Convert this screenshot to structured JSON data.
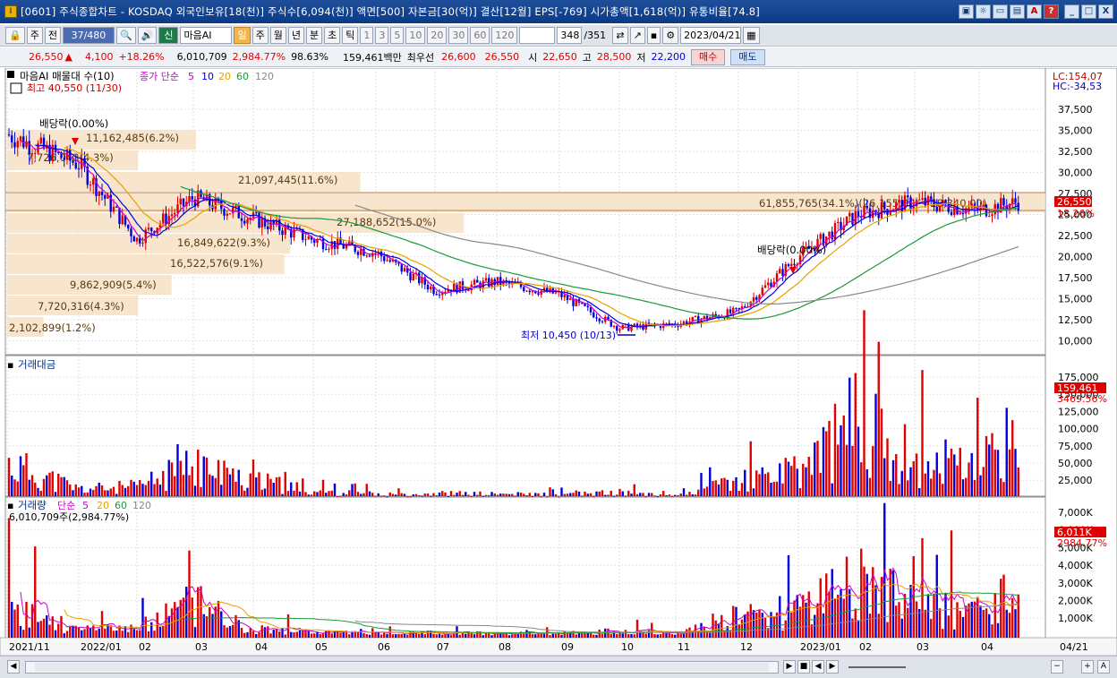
{
  "window": {
    "icon_glyph": "I",
    "title": "[0601] 주식종합차트 - KOSDAQ 외국인보유[18(천)] 주식수[6,094(천)] 액면[500] 자본금[30(억)] 결산[12월] EPS[-769] 시가총액[1,618(억)] 유통비율[74.8]",
    "buttons": [
      "▣",
      "☼",
      "▭",
      "▤",
      "A",
      "?",
      "_",
      "□",
      "X"
    ]
  },
  "toolbar": {
    "mode": "주",
    "range": "전",
    "code": "37/480",
    "name": "마음AI",
    "tag": "신",
    "periods": [
      "일",
      "주",
      "월",
      "년",
      "분",
      "초",
      "틱"
    ],
    "intervals": [
      "1",
      "3",
      "5",
      "10",
      "20",
      "30",
      "60",
      "120"
    ],
    "count": "348",
    "total": "/351",
    "date": "2023/04/21"
  },
  "quote": {
    "price": "26,550",
    "change": "4,100",
    "pct": "+18.26%",
    "volume": "6,010,709",
    "vol_pct": "2,984.77%",
    "strength": "98.63%",
    "amount": "159,461백만",
    "pref_label": "최우선",
    "bid": "26,600",
    "ask": "26,550",
    "open_label": "시",
    "open": "22,650",
    "high_label": "고",
    "high": "28,500",
    "low_label": "저",
    "low": "22,200",
    "buy": "매수",
    "sell": "매도"
  },
  "main_panel": {
    "title": "마음AI 매물대 수(10)",
    "ma_label": "종가 단순",
    "ma_periods": [
      "5",
      "10",
      "20",
      "60",
      "120"
    ],
    "ma_colors": [
      "#cc00cc",
      "#0000dd",
      "#e8a000",
      "#1a9a3a",
      "#888888"
    ],
    "high_note": "최고 40,550 (11/30)",
    "low_note": "최저 10,450 (10/13)",
    "lc": "LC:154,07",
    "hc": "HC:-34,53",
    "price_ticks": [
      "37,500",
      "35,000",
      "32,500",
      "30,000",
      "27,500",
      "25,000",
      "22,500",
      "20,000",
      "17,500",
      "15,000",
      "12,500",
      "10,000"
    ],
    "last_price": "26,550",
    "last_pct": "18.26%",
    "profile": [
      {
        "label": "61,855,765(34.1%)(26,155.00 ~ 28,340.00)",
        "pct": 34.1
      },
      {
        "label": "21,097,445(11.6%)",
        "pct": 11.6
      },
      {
        "label": "11,162,485(6.2%)",
        "pct": 6.2
      },
      {
        "label": "7,726,043(4.3%)",
        "pct": 4.3
      },
      {
        "label": "27,188,652(15.0%)",
        "pct": 15.0
      },
      {
        "label": "16,849,622(9.3%)",
        "pct": 9.3
      },
      {
        "label": "16,522,576(9.1%)",
        "pct": 9.1
      },
      {
        "label": "9,862,909(5.4%)",
        "pct": 5.4
      },
      {
        "label": "7,720,316(4.3%)",
        "pct": 4.3
      },
      {
        "label": "2,102,899(1.2%)",
        "pct": 1.2
      }
    ],
    "dividend_notes": [
      "배당락(0.00%)",
      "배당락(0.00%)"
    ]
  },
  "amount_panel": {
    "title": "거래대금",
    "ticks": [
      "175,000",
      "150,000",
      "125,000",
      "100,000",
      "75,000",
      "50,000",
      "25,000"
    ],
    "last": "159,461",
    "last_pct": "3469.56%"
  },
  "volume_panel": {
    "title": "거래량",
    "ma_label": "단순",
    "ma_periods": [
      "5",
      "20",
      "60",
      "120"
    ],
    "ma_colors": [
      "#cc00cc",
      "#e8a000",
      "#1a9a3a",
      "#888888"
    ],
    "current": "6,010,709주(2,984.77%)",
    "ticks": [
      "7,000K",
      "6,000K",
      "5,000K",
      "4,000K",
      "3,000K",
      "2,000K",
      "1,000K"
    ],
    "last": "6,011K",
    "last_pct": "2984.77%"
  },
  "x_axis": [
    "2021/11",
    "2022/01",
    "02",
    "03",
    "04",
    "05",
    "06",
    "07",
    "08",
    "09",
    "10",
    "11",
    "12",
    "2023/01",
    "02",
    "03",
    "04"
  ],
  "x_axis_end": "04/21",
  "chart_data": {
    "type": "candlestick",
    "x": [
      "2021/11",
      "2022/01",
      "02",
      "03",
      "04",
      "05",
      "06",
      "07",
      "08",
      "09",
      "10",
      "11",
      "12",
      "2023/01",
      "02",
      "03",
      "04",
      "04/21"
    ],
    "close": [
      34500,
      31000,
      22000,
      27000,
      24500,
      22000,
      20500,
      16000,
      17000,
      15500,
      11500,
      12000,
      13500,
      20000,
      25000,
      26500,
      25500,
      26550
    ],
    "ma120": [
      null,
      null,
      null,
      null,
      null,
      25000,
      23500,
      21500,
      20000,
      18500,
      16000,
      14500,
      13800,
      14000,
      16000,
      17500,
      19000,
      20000
    ],
    "ylim": [
      9000,
      39500
    ],
    "volume_k": [
      3500,
      800,
      900,
      4200,
      900,
      500,
      300,
      400,
      300,
      300,
      600,
      300,
      2500,
      3000,
      7100,
      3500,
      2800,
      6011
    ],
    "amount_m": [
      80000,
      20000,
      25000,
      75000,
      40000,
      15000,
      8000,
      10000,
      8000,
      7000,
      12000,
      6000,
      40000,
      60000,
      185000,
      90000,
      70000,
      159461
    ]
  }
}
